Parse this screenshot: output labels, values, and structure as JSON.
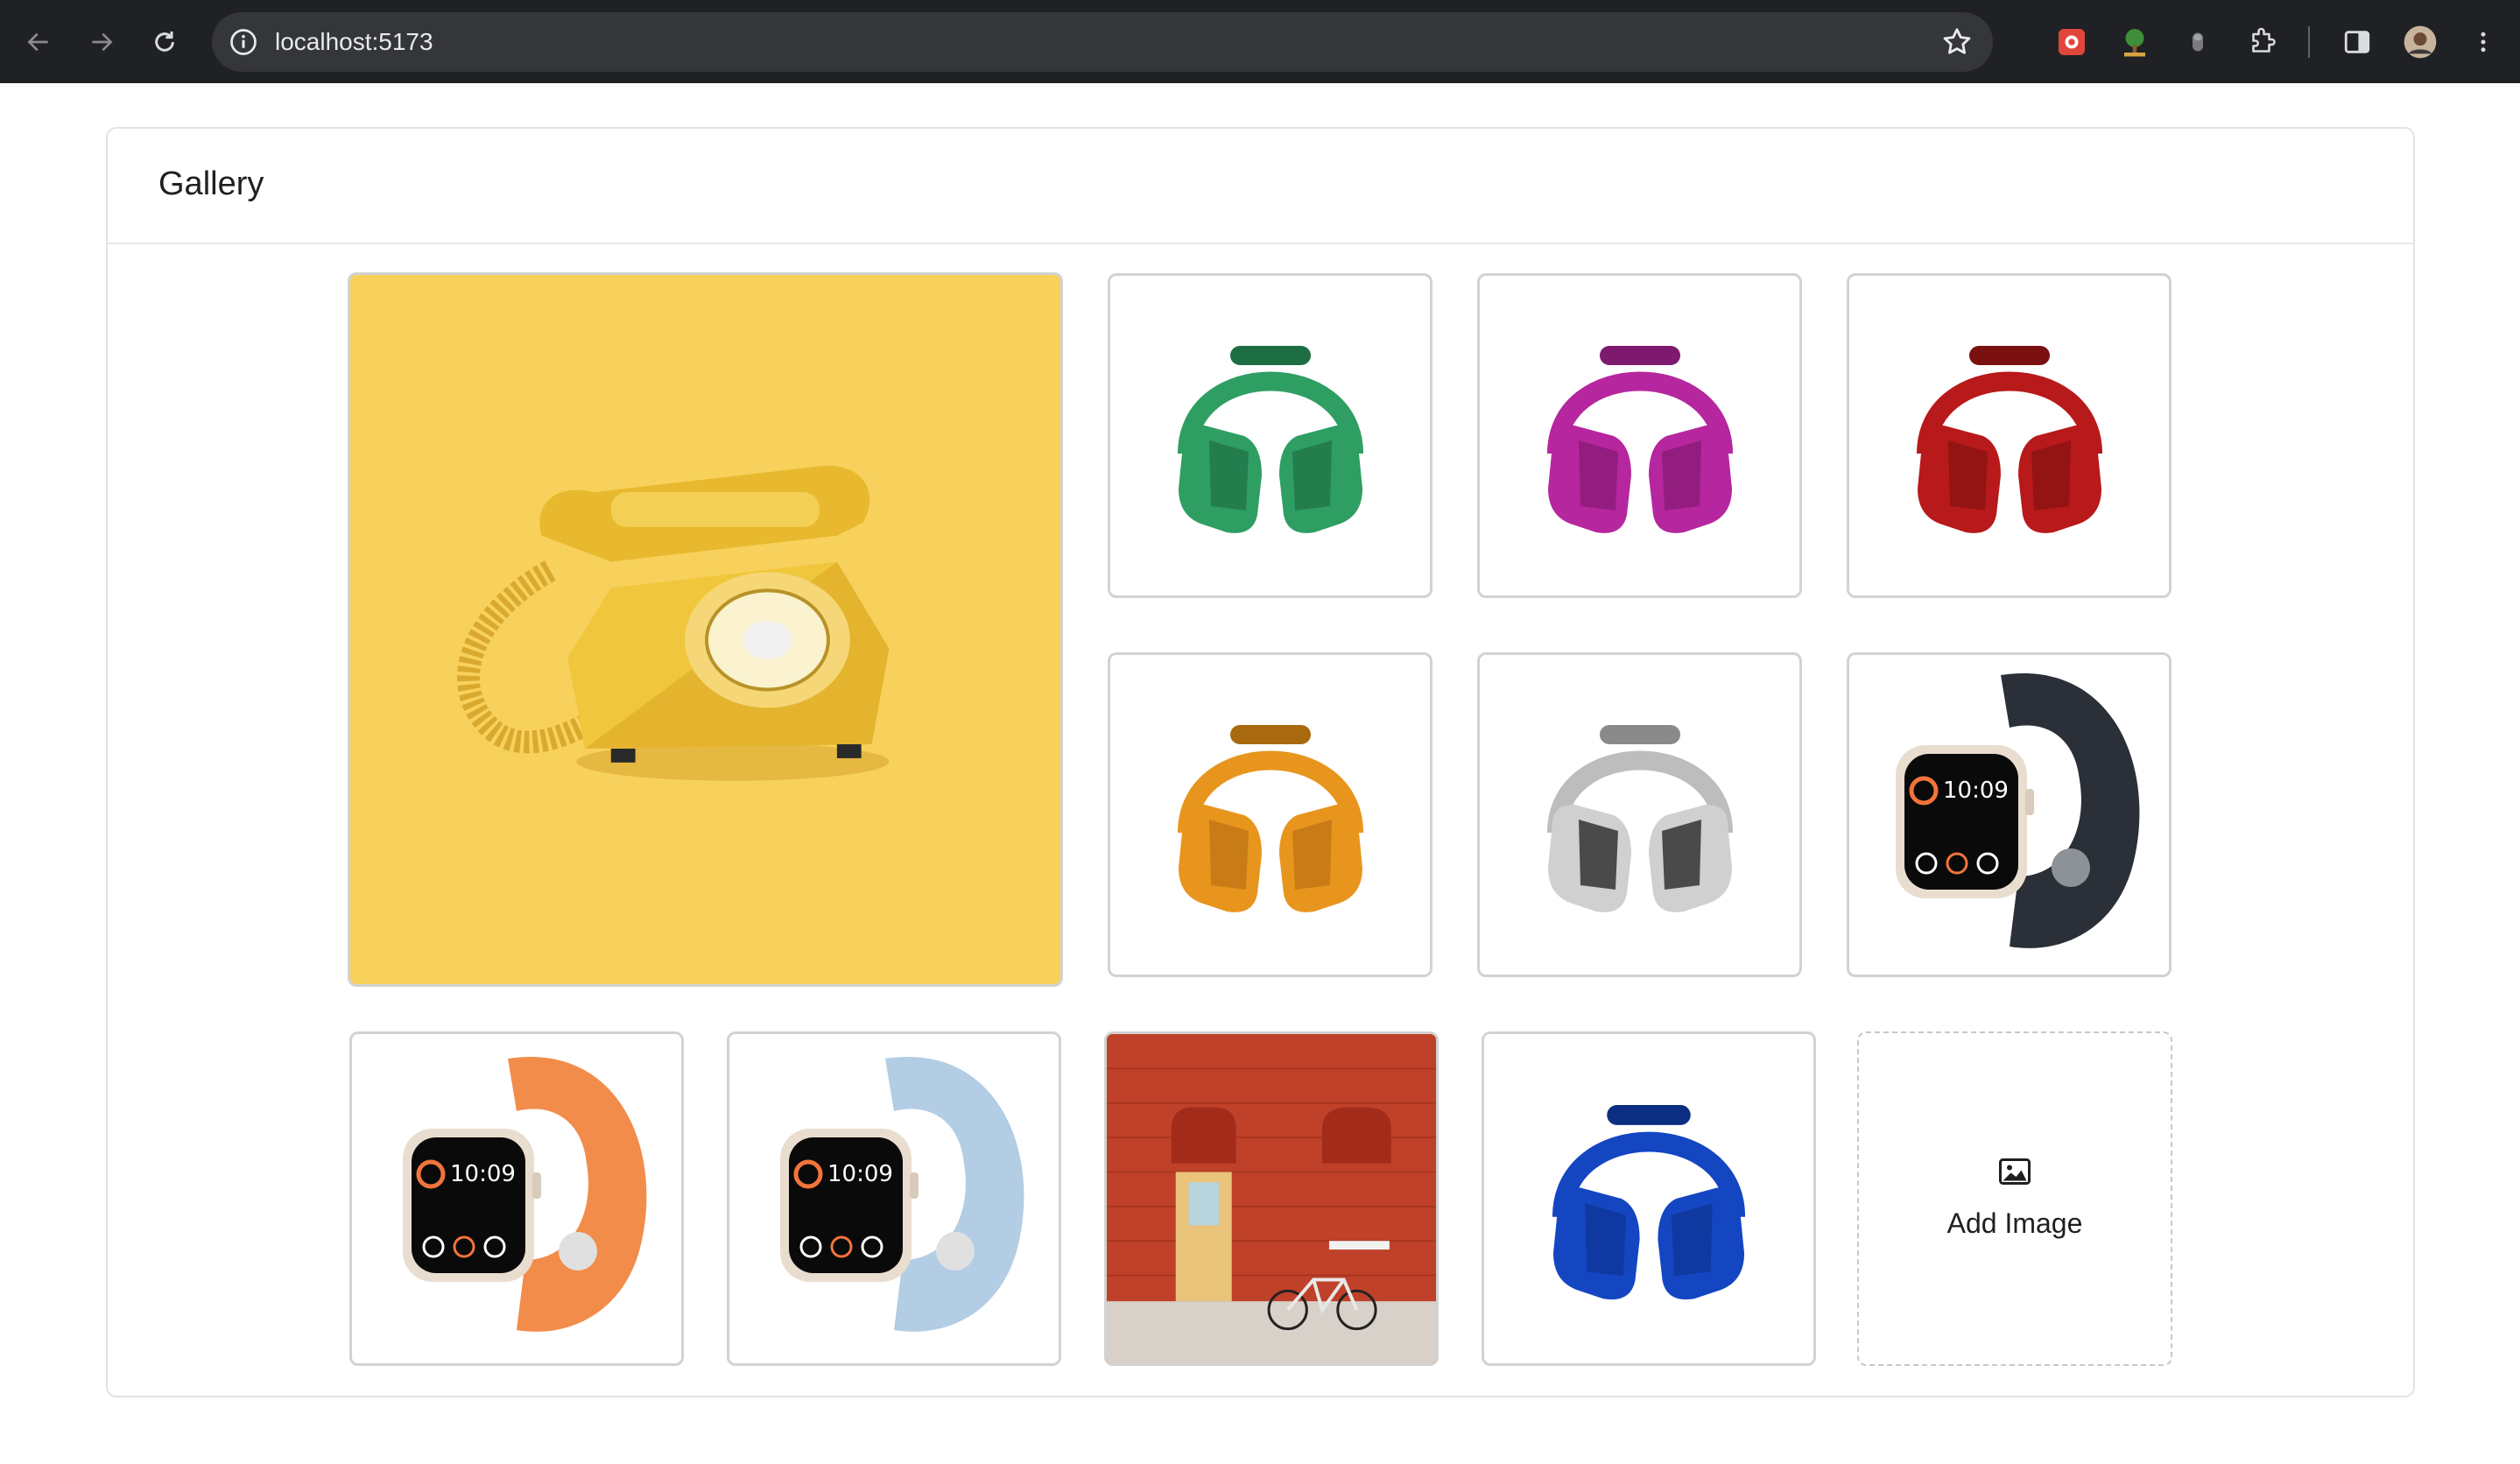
{
  "browser": {
    "url": "localhost:5173",
    "icons": [
      "back-icon",
      "forward-icon",
      "reload-icon",
      "site-info-icon",
      "bookmark-star-icon",
      "extension-puzzle-icon",
      "side-panel-icon",
      "profile-avatar",
      "more-menu-icon"
    ]
  },
  "gallery": {
    "title": "Gallery",
    "items": [
      {
        "subject": "telephone",
        "color": "#f7d15c"
      },
      {
        "subject": "headphones",
        "color": "#2e9e62"
      },
      {
        "subject": "headphones",
        "color": "#b6269e"
      },
      {
        "subject": "headphones",
        "color": "#b8191a"
      },
      {
        "subject": "headphones",
        "color": "#e8951e"
      },
      {
        "subject": "headphones",
        "color": "#bdbdbd"
      },
      {
        "subject": "watch",
        "color": "#2a2f38"
      },
      {
        "subject": "watch",
        "color": "#f28c4b"
      },
      {
        "subject": "watch",
        "color": "#b2cde4"
      },
      {
        "subject": "red-brick-door",
        "color": "#c0412a"
      },
      {
        "subject": "headphones",
        "color": "#1446c2"
      }
    ],
    "add_label": "Add Image"
  }
}
